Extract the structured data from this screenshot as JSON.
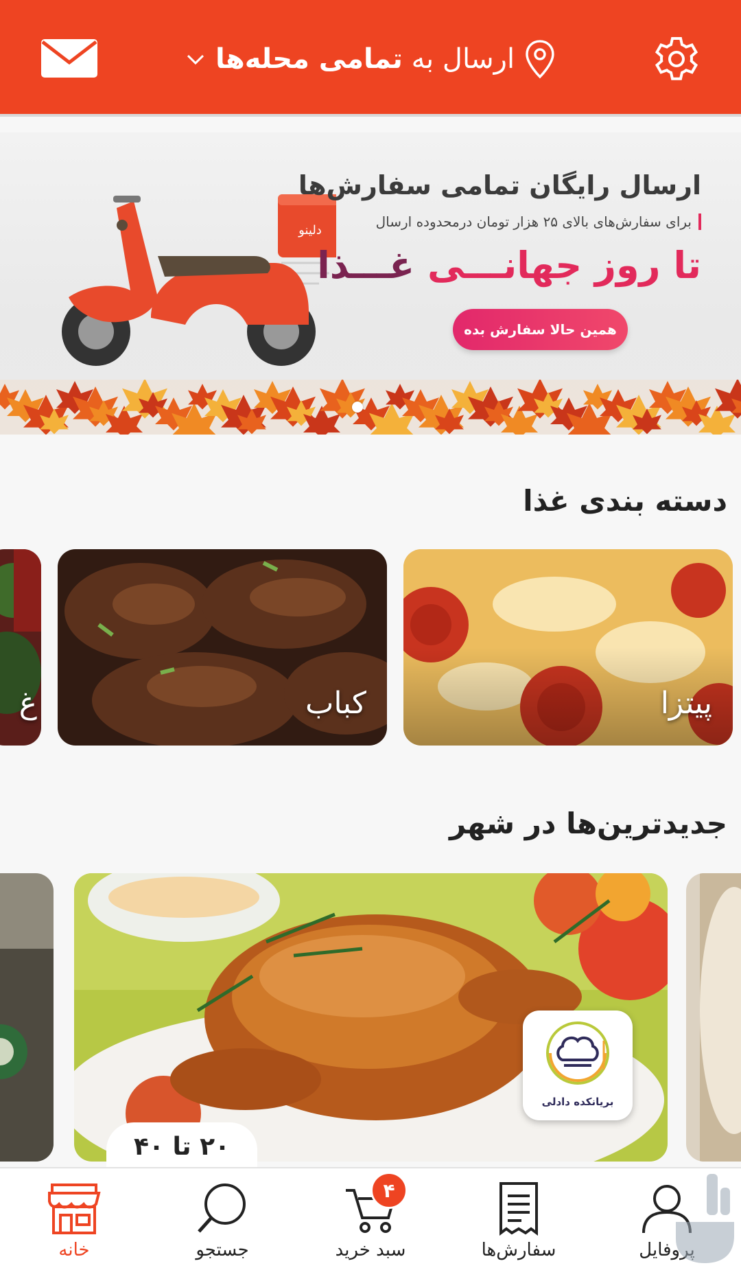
{
  "header": {
    "location_prefix": "ارسال به",
    "location_value": "تمامی محله‌ها"
  },
  "banner": {
    "title": "ارسال رایگان تمامی سفارش‌ها",
    "subtitle": "برای سفارش‌های بالای ۲۵ هزار تومان درمحدوده ارسال",
    "headline_a": "تا روز جهانـــی",
    "headline_b": "غـــذا",
    "cta": "همین حالا سفارش بده",
    "box_logo": "دلینو",
    "active_slide": 1
  },
  "categories": {
    "title": "دسته بندی غذا",
    "items": [
      {
        "label": "پیتزا"
      },
      {
        "label": "کباب"
      },
      {
        "label": "غ"
      }
    ]
  },
  "newest": {
    "title": "جدیدترین‌ها در شهر",
    "restaurant_name": "بریانکده دادلی",
    "delivery_time": "۲۰ تا ۴۰"
  },
  "bottom_nav": {
    "items": [
      {
        "label": "پروفایل"
      },
      {
        "label": "سفارش‌ها"
      },
      {
        "label": "سبد خرید"
      },
      {
        "label": "جستجو"
      },
      {
        "label": "خانه"
      }
    ],
    "cart_count": "۴"
  },
  "colors": {
    "primary": "#ee4422",
    "banner_accent": "#e22a5b",
    "background": "#f7f7f7"
  }
}
